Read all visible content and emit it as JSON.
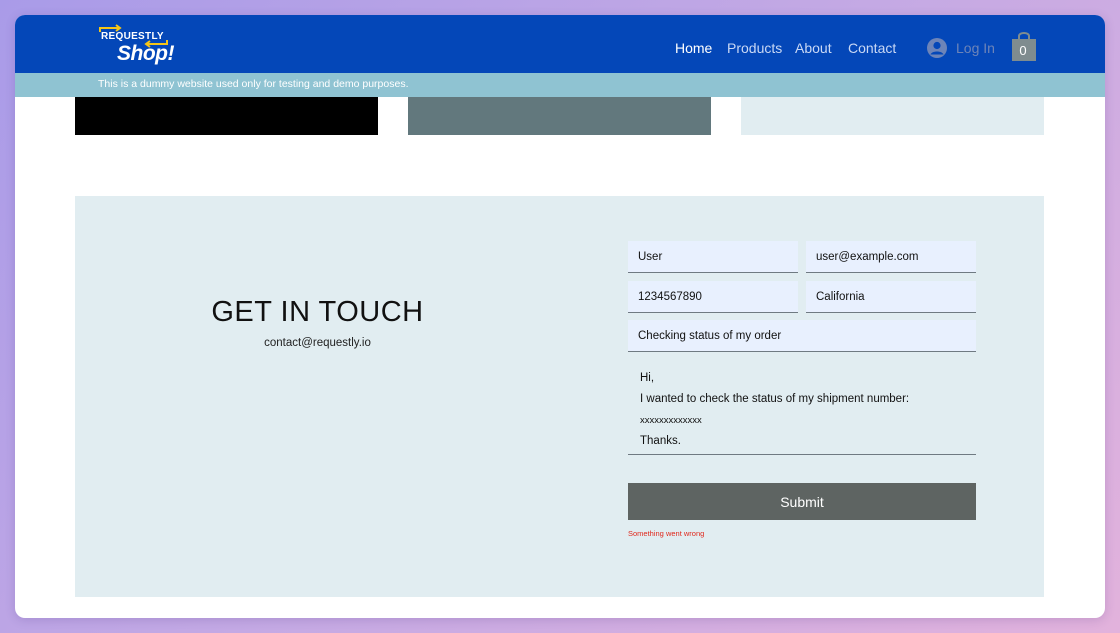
{
  "header": {
    "logo": {
      "top_text": "REQUESTLY",
      "main_text": "Shop!"
    },
    "nav": [
      "Home",
      "Products",
      "About",
      "Contact"
    ],
    "login_label": "Log In",
    "cart_count": "0"
  },
  "banner": {
    "text": "This is a dummy website used only for testing and demo purposes."
  },
  "contact": {
    "title": "GET IN TOUCH",
    "email": "contact@requestly.io",
    "form": {
      "name": "User",
      "email": "user@example.com",
      "phone": "1234567890",
      "state": "California",
      "subject": "Checking status of my order",
      "message_lines": [
        "Hi,",
        "I wanted to check the status of my shipment number:",
        "xxxxxxxxxxxxx",
        "Thanks."
      ],
      "submit_label": "Submit",
      "error_text": "Something went wrong"
    }
  },
  "colors": {
    "header_bg": "#0447b8",
    "banner_bg": "#8fc3d2",
    "section_bg": "#e1edf1",
    "input_bg": "#e8f0fe",
    "submit_bg": "#5e6462",
    "error": "#e0281c",
    "logo_accent": "#f5c518"
  },
  "icons": {
    "login": "user-avatar-icon",
    "cart": "shopping-bag-icon",
    "logo": "swap-arrows-icon"
  }
}
